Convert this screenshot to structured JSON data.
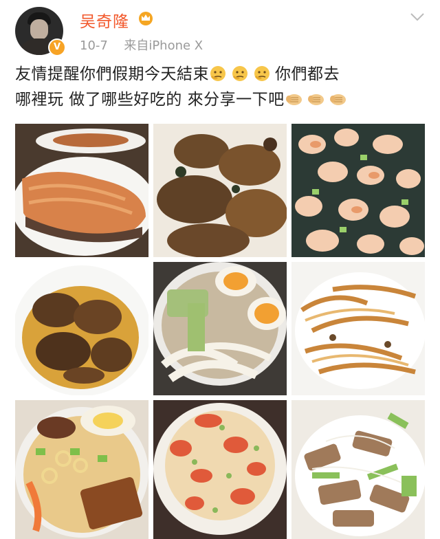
{
  "post": {
    "username": "吴奇隆",
    "date": "10-7",
    "source": "来自iPhone X",
    "text_line1_start": "友情提醒你們假期今天結束",
    "text_line1_end": "你們都去",
    "text_line2_start": "哪裡玩 做了哪些好吃的 來分享一下吧",
    "icons": {
      "avatar": "user-avatar",
      "verified": "verified-v-badge",
      "vip": "crown-icon",
      "more": "chevron-down-icon",
      "emoji1": "thinking-face-emoji",
      "emoji2": "fist-emoji"
    },
    "verified_letter": "V",
    "photos": [
      "salmon-steak-photo",
      "braised-chicken-wings-photo",
      "shrimp-stir-fry-photo",
      "braised-beef-photo",
      "udon-soup-with-eggs-photo",
      "fried-noodles-photo",
      "noodle-soup-with-tofu-photo",
      "tomato-egg-rice-photo",
      "tofu-celery-stir-fry-photo"
    ]
  }
}
